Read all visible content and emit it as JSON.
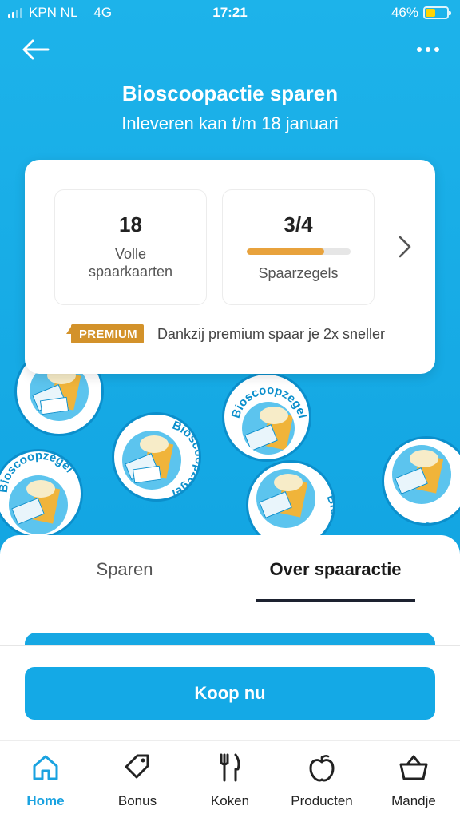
{
  "status_bar": {
    "carrier": "KPN NL",
    "network": "4G",
    "time": "17:21",
    "battery": "46%",
    "battery_level": 0.46
  },
  "header": {
    "title": "Bioscoopactie sparen",
    "subtitle": "Inleveren kan t/m 18 januari"
  },
  "card": {
    "full_cards": {
      "value": "18",
      "label_line1": "Volle",
      "label_line2": "spaarkaarten"
    },
    "stamps": {
      "value": "3/4",
      "label": "Spaarzegels",
      "progress": 0.75
    },
    "premium_badge": "PREMIUM",
    "premium_text": "Dankzij premium spaar je 2x sneller"
  },
  "stamp_text": "Bioscoopzegel",
  "stamp_ticket": "TICKET",
  "tabs": [
    {
      "label": "Sparen"
    },
    {
      "label": "Over spaaractie"
    }
  ],
  "buy_button": "Koop nu",
  "bottom_nav": [
    {
      "label": "Home",
      "icon": "home-icon"
    },
    {
      "label": "Bonus",
      "icon": "tag-icon"
    },
    {
      "label": "Koken",
      "icon": "cutlery-icon"
    },
    {
      "label": "Producten",
      "icon": "apple-icon"
    },
    {
      "label": "Mandje",
      "icon": "basket-icon"
    }
  ],
  "colors": {
    "primary": "#14a9e6",
    "premium": "#d3922a",
    "progress": "#e8a23c",
    "battery": "#ffd400"
  }
}
